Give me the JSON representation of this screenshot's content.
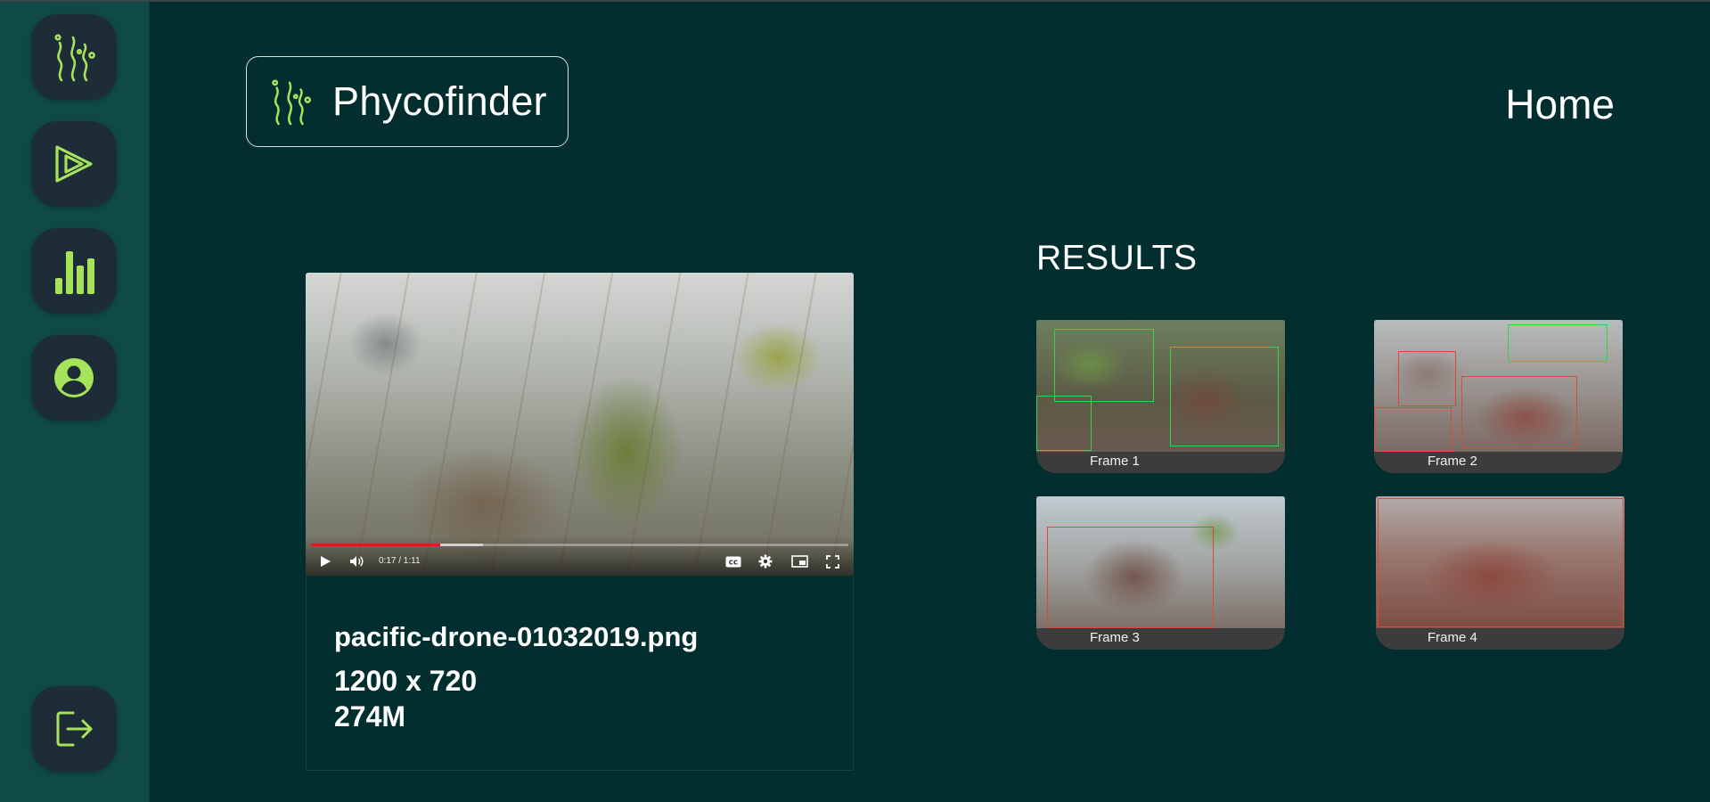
{
  "app": {
    "name": "Phycofinder"
  },
  "nav": {
    "home_label": "Home",
    "sidebar": [
      {
        "icon": "seaweed-logo-icon"
      },
      {
        "icon": "play-icon"
      },
      {
        "icon": "bar-chart-icon"
      },
      {
        "icon": "account-icon"
      },
      {
        "icon": "logout-icon"
      }
    ]
  },
  "video": {
    "time_display": "0:17 / 1:11",
    "progress_fraction": 0.24,
    "buffered_fraction": 0.32
  },
  "file": {
    "name": "pacific-drone-01032019.png",
    "dimensions": "1200 x 720",
    "size": "274M"
  },
  "results": {
    "title": "RESULTS",
    "frames": [
      {
        "label": "Frame 1"
      },
      {
        "label": "Frame 2"
      },
      {
        "label": "Frame 3"
      },
      {
        "label": "Frame 4"
      }
    ]
  },
  "colors": {
    "background": "#032e2f",
    "sidebar": "#104a47",
    "accent": "#a6e35a",
    "button": "#1d2c36",
    "progress": "#e01b1b"
  }
}
